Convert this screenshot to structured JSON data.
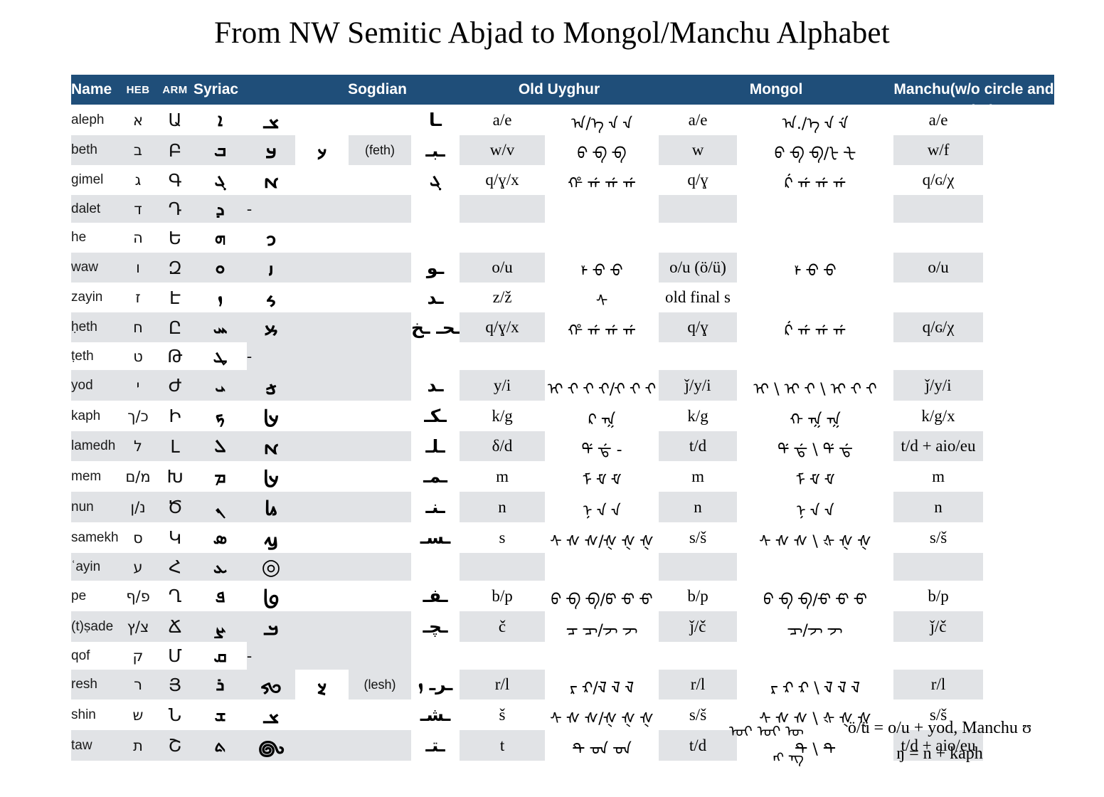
{
  "title": "From NW Semitic Abjad to Mongol/Manchu Alphabet",
  "header": {
    "accent_color": "#1F4E79",
    "stripe_color": "#E1E3E6",
    "name": "Name",
    "heb": "HEB",
    "arm": "ARM",
    "syriac": "Syriac",
    "sogdian": "Sogdian",
    "old_uyghur": "Old Uyghur",
    "mongol": "Mongol",
    "manchu": "Manchu(w/o circle and point)"
  },
  "rows": [
    {
      "name": "aleph",
      "heb": "א",
      "arm": "Ա",
      "syriac": "ܐ",
      "sogdian1": "𐼰",
      "sogdian2": "",
      "sogdian_label": "",
      "uyghur_glyph": "ـا",
      "uyghur": "a/e",
      "mongol_glyph": "ᠠ/ᡝ ᠊ᠠ ᠊ᠡ",
      "mongol": "a/e",
      "manchu_glyph": "ᠠ./ᡝ ᠊ᠠ ᠊ᡝ",
      "manchu": "a/e",
      "shaded": false
    },
    {
      "name": "beth",
      "heb": "ב",
      "arm": "Բ",
      "syriac": "ܒ",
      "sogdian1": "𐼂",
      "sogdian2": "𐽀",
      "sogdian_label": "(feth)",
      "uyghur_glyph": "ـبـ",
      "uyghur": "w/v",
      "mongol_glyph": "ᠪ ᠊ᠪ ᠊ᠪ",
      "mongol": "w",
      "manchu_glyph": "ᠪ ᠊ᠪ ᠊ᠪ/ᡶ ᠊ᡶ",
      "manchu": "w/f",
      "shaded": true
    },
    {
      "name": "gimel",
      "heb": "ג",
      "arm": "Գ",
      "syriac": "ܓ",
      "sogdian1": "𐼄",
      "sogdian2": "",
      "sogdian_label": "",
      "uyghur_glyph": "ܓ",
      "uyghur": "q/ɣ/x",
      "mongol_glyph": "ᡥ ᠊ᡤ ᠊ᡤ ᠊ᡤ",
      "mongol": "q/ɣ",
      "manchu_glyph": "ᡬ ᠊ᡤ ᠊ᡤ ᠊ᡤ",
      "manchu": "q/ɢ/χ",
      "shaded": false
    },
    {
      "name": "dalet",
      "heb": "ד",
      "arm": "Դ",
      "syriac": "ܕ",
      "sogdian1": "-",
      "sogdian2": "",
      "sogdian_label": "",
      "uyghur_glyph": "",
      "uyghur": "",
      "mongol_glyph": "",
      "mongol": "",
      "manchu_glyph": "",
      "manchu": "",
      "shaded": true
    },
    {
      "name": "he",
      "heb": "ה",
      "arm": "Ե",
      "syriac": "ܗ",
      "sogdian1": "𐼇",
      "sogdian2": "",
      "sogdian_label": "",
      "uyghur_glyph": "",
      "uyghur": "",
      "mongol_glyph": "",
      "mongol": "",
      "manchu_glyph": "",
      "manchu": "",
      "shaded": false
    },
    {
      "name": "waw",
      "heb": "ו",
      "arm": "Զ",
      "syriac": "ܘ",
      "sogdian1": "𐼈",
      "sogdian2": "",
      "sogdian_label": "",
      "uyghur_glyph": "ـو",
      "uyghur": "o/u",
      "mongol_glyph": "ᡟ ᠊ᠣ ᠊ᠣ",
      "mongol": "o/u (ö/ü)",
      "manchu_glyph": "ᡟ ᠊ᠣ ᠊ᠣ",
      "manchu": "o/u",
      "shaded": true
    },
    {
      "name": "zayin",
      "heb": "ז",
      "arm": "Է",
      "syriac": "ܙ",
      "sogdian1": "𐼊",
      "sogdian2": "",
      "sogdian_label": "",
      "uyghur_glyph": "ـد",
      "uyghur": "z/ž",
      "mongol_glyph": "ᠰ",
      "mongol": "old final s",
      "manchu_glyph": "",
      "manchu": "",
      "shaded": false
    },
    {
      "name": "ḥeth",
      "heb": "ח",
      "arm": "Ը",
      "syriac": "ܚ",
      "sogdian1": "𐼍",
      "sogdian2": "",
      "sogdian_label": "",
      "uyghur_glyph": "ـحـ ـخ",
      "uyghur": "q/ɣ/x",
      "mongol_glyph": "ᡥ ᠊ᡤ ᠊ᡤ ᠊ᡤ",
      "mongol": "q/ɣ",
      "manchu_glyph": "ᡬ ᠊ᡤ ᠊ᡤ ᠊ᡤ",
      "manchu": "q/ɢ/χ",
      "shaded": true
    },
    {
      "name": "ṭeth",
      "heb": "ט",
      "arm": "Թ",
      "syriac": "ܛ",
      "sogdian1": "-",
      "sogdian2": "",
      "sogdian_label": "",
      "uyghur_glyph": "",
      "uyghur": "",
      "mongol_glyph": "",
      "mongol": "",
      "manchu_glyph": "",
      "manchu": "",
      "shaded": false
    },
    {
      "name": "yod",
      "heb": "י",
      "arm": "Ժ",
      "syriac": "ܝ",
      "sogdian1": "𐼺",
      "sogdian2": "",
      "sogdian_label": "",
      "uyghur_glyph": "ـد",
      "uyghur": "y/i",
      "mongol_glyph": "ᡳ ᠊ᡳ ᠊ᡳ ᠊ᡳ/᠊ᡳ ᠊ᡳ ᠊ᡳ",
      "mongol": "ǰ/y/i",
      "manchu_glyph": "ᡳ \\ ᡳ ᠊ᡳ \\ ᡳ ᠊ᡳ ᠊ᡳ",
      "manchu": "ǰ/y/i",
      "shaded": true
    },
    {
      "name": "kaph",
      "heb": "כ/ך",
      "arm": "Ի",
      "syriac": "ܟ",
      "sogdian1": "𐼸",
      "sogdian2": "",
      "sogdian_label": "",
      "uyghur_glyph": "ـكـ",
      "uyghur": "k/g",
      "mongol_glyph": "ᠺ ᠊ᡴ",
      "mongol": "k/g",
      "manchu_glyph": "ᡴ ᠊ᡴ ᠊ᡴ",
      "manchu": "k/g/x",
      "shaded": false
    },
    {
      "name": "lamedh",
      "heb": "ל",
      "arm": "Լ",
      "syriac": "ܠ",
      "sogdian1": "𐼄",
      "sogdian2": "",
      "sogdian_label": "",
      "uyghur_glyph": "ـلـ",
      "uyghur": "δ/d",
      "mongol_glyph": "ᡩ ᠊ᡩ - ",
      "mongol": "t/d",
      "manchu_glyph": "ᡩ ᠊ᡩ \\ ᡩ ᠊ᡩ",
      "manchu": "t/d + aio/eu",
      "shaded": true
    },
    {
      "name": "mem",
      "heb": "מ/ם",
      "arm": "Խ",
      "syriac": "ܡ",
      "sogdian1": "𐼸",
      "sogdian2": "",
      "sogdian_label": "",
      "uyghur_glyph": "ـمـ",
      "uyghur": "m",
      "mongol_glyph": "ᠮ ᠊ᠮ ᠊ᠮ",
      "mongol": "m",
      "manchu_glyph": "ᠮ ᠊ᠮ ᠊ᠮ",
      "manchu": "m",
      "shaded": false
    },
    {
      "name": "nun",
      "heb": "נ/ן",
      "arm": "Ծ",
      "syriac": "ܢ",
      "sogdian1": "𐼻",
      "sogdian2": "",
      "sogdian_label": "",
      "uyghur_glyph": "ـنـ",
      "uyghur": "n",
      "mongol_glyph": "ᠨ ᠊ᠨ ᠊ᠨ",
      "mongol": "n",
      "manchu_glyph": "ᠨ ᠊ᠨ ᠊ᠨ",
      "manchu": "n",
      "shaded": true
    },
    {
      "name": "samekh",
      "heb": "ס",
      "arm": "Կ",
      "syriac": "ܣ",
      "sogdian1": "𐼼",
      "sogdian2": "",
      "sogdian_label": "",
      "uyghur_glyph": "ـسـ",
      "uyghur": "s",
      "mongol_glyph": "ᠰ ᠊ᠰ ᠊ᠰ/᠊ᡧ ᠊ᡧ ᠊ᡧ",
      "mongol": "s/š",
      "manchu_glyph": "ᠰ ᠊ᠰ ᠊ᠰ \\ ᡧ ᠊ᡧ ᠊ᡧ",
      "manchu": "s/š",
      "shaded": false
    },
    {
      "name": "ʿayin",
      "heb": "ע",
      "arm": "Հ",
      "syriac": "ܥ",
      "sogdian1": "◎",
      "sogdian2": "",
      "sogdian_label": "",
      "uyghur_glyph": "",
      "uyghur": "",
      "mongol_glyph": "",
      "mongol": "",
      "manchu_glyph": "",
      "manchu": "",
      "shaded": true
    },
    {
      "name": "pe",
      "heb": "פ/ף",
      "arm": "Ղ",
      "syriac": "ܦ",
      "sogdian1": "𐼾",
      "sogdian2": "",
      "sogdian_label": "",
      "uyghur_glyph": "ـفـ",
      "uyghur": "b/p",
      "mongol_glyph": "ᠪ ᠊ᠪ ᠊ᠪ/ᡦ ᠊ᡦ ᠊ᡦ",
      "mongol": "b/p",
      "manchu_glyph": "ᠪ ᠊ᠪ ᠊ᠪ/᠊ᡦ ᠊ᡦ ᠊ᡦ",
      "manchu": "b/p",
      "shaded": false
    },
    {
      "name": "(t)ṣade",
      "heb": "צ/ץ",
      "arm": "Ճ",
      "syriac": "ܨ",
      "sogdian1": "𐼱",
      "sogdian2": "",
      "sogdian_label": "",
      "uyghur_glyph": "ـچـ",
      "uyghur": "č",
      "mongol_glyph": "ᠴ ᠊ᠴ/᠊ᠵ ᠊ᠵ",
      "mongol": "ǰ/č",
      "manchu_glyph": "᠊ᠴ/᠊ᠵ ᠊ᠵ",
      "manchu": "ǰ/č",
      "shaded": true
    },
    {
      "name": "qof",
      "heb": "ק",
      "arm": "Մ",
      "syriac": "ܩ",
      "sogdian1": "-",
      "sogdian2": "",
      "sogdian_label": "",
      "uyghur_glyph": "",
      "uyghur": "",
      "mongol_glyph": "",
      "mongol": "",
      "manchu_glyph": "",
      "manchu": "",
      "shaded": false
    },
    {
      "name": "resh",
      "heb": "ר",
      "arm": "Յ",
      "syriac": "ܪ",
      "sogdian1": "𐼓",
      "sogdian2": "𐽄",
      "sogdian_label": "(lesh)",
      "uyghur_glyph": "ـرـ",
      "uyghur_extra": "ܙ",
      "uyghur": "r/l",
      "mongol_glyph": "ᠷ ᠊ᠷ/᠊ᠯ ᠊ᠯ ᠊ᠯ",
      "mongol": "r/l",
      "manchu_glyph": "ᠷ ᠊ᠷ ᠊ᠷ \\ ᠊ᠯ ᠊ᠯ ᠊ᠯ",
      "manchu": "r/l",
      "shaded": true
    },
    {
      "name": "shin",
      "heb": "ש",
      "arm": "Ն",
      "syriac": "ܫ",
      "sogdian1": "𐼰",
      "sogdian2": "",
      "sogdian_label": "",
      "uyghur_glyph": "ـشـ",
      "uyghur": "š",
      "mongol_glyph": "ᠰ ᠊ᠰ ᠊ᠰ/᠊ᡧ ᠊ᡧ ᠊ᡧ",
      "mongol": "s/š",
      "manchu_glyph": "ᠰ ᠊ᠰ ᠊ᠰ \\ ᡧ ᠊ᡧ ᠊ᡧ",
      "manchu": "s/š",
      "shaded": false
    },
    {
      "name": "taw",
      "heb": "ת",
      "arm": "Շ",
      "syriac": "ܬ",
      "sogdian1": "𐼽",
      "sogdian2": "",
      "sogdian_label": "",
      "uyghur_glyph": "ـتـ",
      "uyghur": "t",
      "mongol_glyph": "ᡨ ᠊ᡨ ᠊ᡨ",
      "mongol": "t/d",
      "manchu_glyph": "ᡨ \\ ᡨ",
      "manchu": "t/d + aio/eu",
      "shaded": true
    }
  ],
  "footnotes": [
    {
      "glyph": "ᠣᠢ ᠣᠢ ᠦ",
      "text": "ö/ü = o/u + yod, Manchu ʊ"
    },
    {
      "glyph": "ᠩ ᠊ᠩ",
      "text": "ŋ = n + kaph"
    }
  ]
}
